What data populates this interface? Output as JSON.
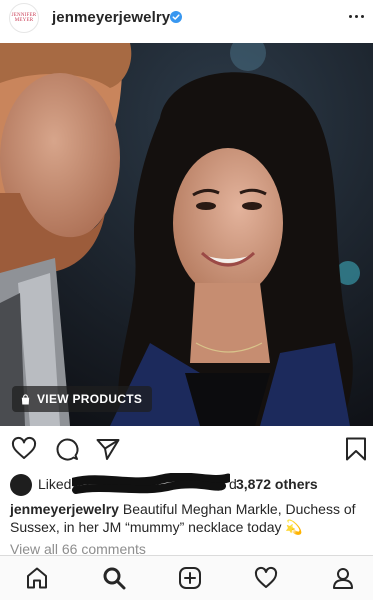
{
  "header": {
    "avatar_text_line1": "JENNIFER",
    "avatar_text_line2": "MEYER",
    "username": "jenmeyerjewelry",
    "verified_icon": "verified-badge-icon",
    "more_icon": "more-dots-icon"
  },
  "post": {
    "view_products_label": "VIEW PRODUCTS",
    "bag_icon": "shopping-bag-icon"
  },
  "actions": {
    "like_icon": "heart-icon",
    "comment_icon": "comment-icon",
    "share_icon": "paper-plane-icon",
    "save_icon": "bookmark-icon"
  },
  "likes": {
    "prefix": "Liked",
    "suffix": "d",
    "count_text": "3,872 others"
  },
  "caption": {
    "username": "jenmeyerjewelry",
    "text": "Beautiful Meghan Markle, Duchess of Sussex, in her JM “mummy” necklace today",
    "emoji": "💫"
  },
  "comments": {
    "view_all_label": "View all 66 comments"
  },
  "nav": {
    "home_icon": "home-icon",
    "search_icon": "search-icon",
    "new_post_icon": "add-post-icon",
    "activity_icon": "activity-heart-icon",
    "profile_icon": "profile-icon"
  },
  "colors": {
    "text": "#262626",
    "muted": "#8e8e8e",
    "verified": "#3897f0",
    "avatar_brand": "#c93a52"
  }
}
